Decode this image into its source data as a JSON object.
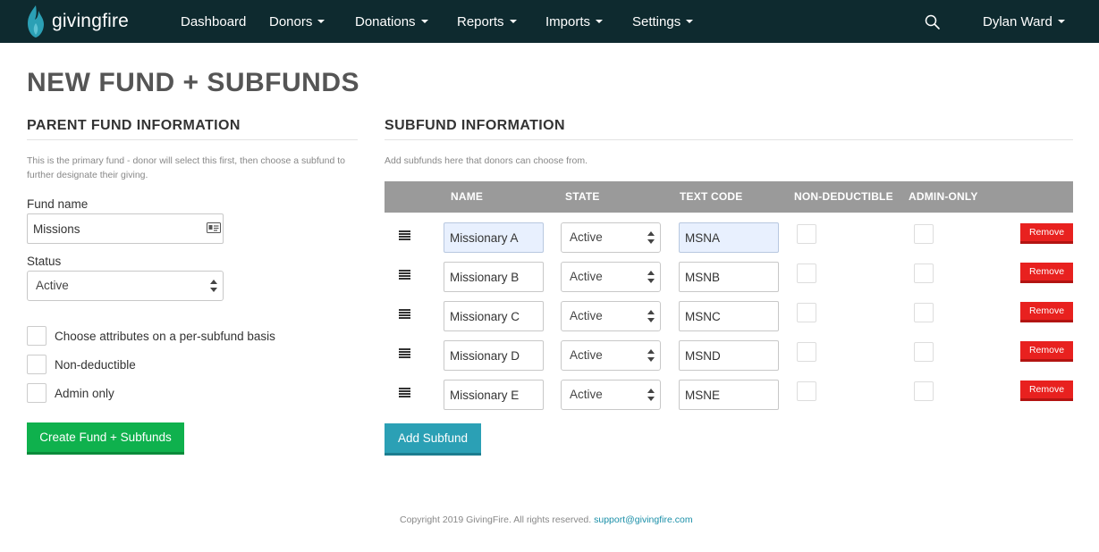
{
  "nav": {
    "brand": "givingfire",
    "items": [
      "Dashboard",
      "Donors",
      "Donations",
      "Reports",
      "Imports",
      "Settings"
    ],
    "user": "Dylan Ward"
  },
  "page": {
    "title": "NEW FUND + SUBFUNDS"
  },
  "parent": {
    "title": "PARENT FUND INFORMATION",
    "help": "This is the primary fund - donor will select this first, then choose a subfund to further designate their giving.",
    "fund_name_label": "Fund name",
    "fund_name_value": "Missions",
    "status_label": "Status",
    "status_value": "Active",
    "checkboxes": [
      {
        "label": "Choose attributes on a per-subfund basis",
        "checked": false
      },
      {
        "label": "Non-deductible",
        "checked": false
      },
      {
        "label": "Admin only",
        "checked": false
      }
    ],
    "create_button": "Create Fund + Subfunds"
  },
  "subfunds": {
    "title": "SUBFUND INFORMATION",
    "help": "Add subfunds here that donors can choose from.",
    "columns": [
      "NAME",
      "STATE",
      "TEXT CODE",
      "NON-DEDUCTIBLE",
      "ADMIN-ONLY"
    ],
    "rows": [
      {
        "name": "Missionary A",
        "state": "Active",
        "code": "MSNA",
        "non_deductible": false,
        "admin_only": false,
        "remove": "Remove"
      },
      {
        "name": "Missionary B",
        "state": "Active",
        "code": "MSNB",
        "non_deductible": false,
        "admin_only": false,
        "remove": "Remove"
      },
      {
        "name": "Missionary C",
        "state": "Active",
        "code": "MSNC",
        "non_deductible": false,
        "admin_only": false,
        "remove": "Remove"
      },
      {
        "name": "Missionary D",
        "state": "Active",
        "code": "MSND",
        "non_deductible": false,
        "admin_only": false,
        "remove": "Remove"
      },
      {
        "name": "Missionary E",
        "state": "Active",
        "code": "MSNE",
        "non_deductible": false,
        "admin_only": false,
        "remove": "Remove"
      }
    ],
    "add_button": "Add Subfund"
  },
  "footer": {
    "copyright": "Copyright 2019 GivingFire. All rights reserved.",
    "email": "support@givingfire.com"
  },
  "colors": {
    "navbar": "#0e2a2f",
    "brand_flame": "#2ba0b5",
    "create_button": "#0fb14d",
    "add_button": "#2ba0b5",
    "remove_button": "#e8211f",
    "table_header": "#9a9a9a"
  }
}
